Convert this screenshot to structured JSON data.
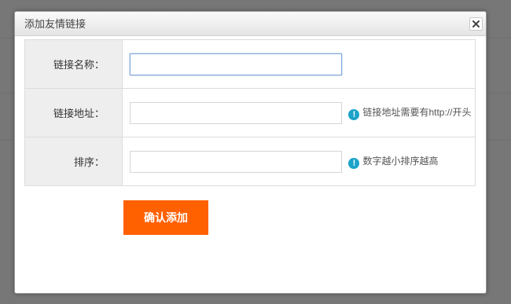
{
  "dialog": {
    "title": "添加友情链接",
    "close_icon": "close-icon"
  },
  "form": {
    "fields": [
      {
        "label": "链接名称：",
        "value": "",
        "focused": true,
        "hint": ""
      },
      {
        "label": "链接地址：",
        "value": "",
        "hint": "链接地址需要有http://开头",
        "hint_icon": "info-icon"
      },
      {
        "label": "排序：",
        "value": "",
        "hint": "数字越小排序越高",
        "hint_icon": "info-icon"
      }
    ],
    "submit_label": "确认添加"
  },
  "colors": {
    "submit_bg": "#ff6000",
    "hint_icon": "#1ca3c9",
    "label_bg": "#eeeeee"
  }
}
